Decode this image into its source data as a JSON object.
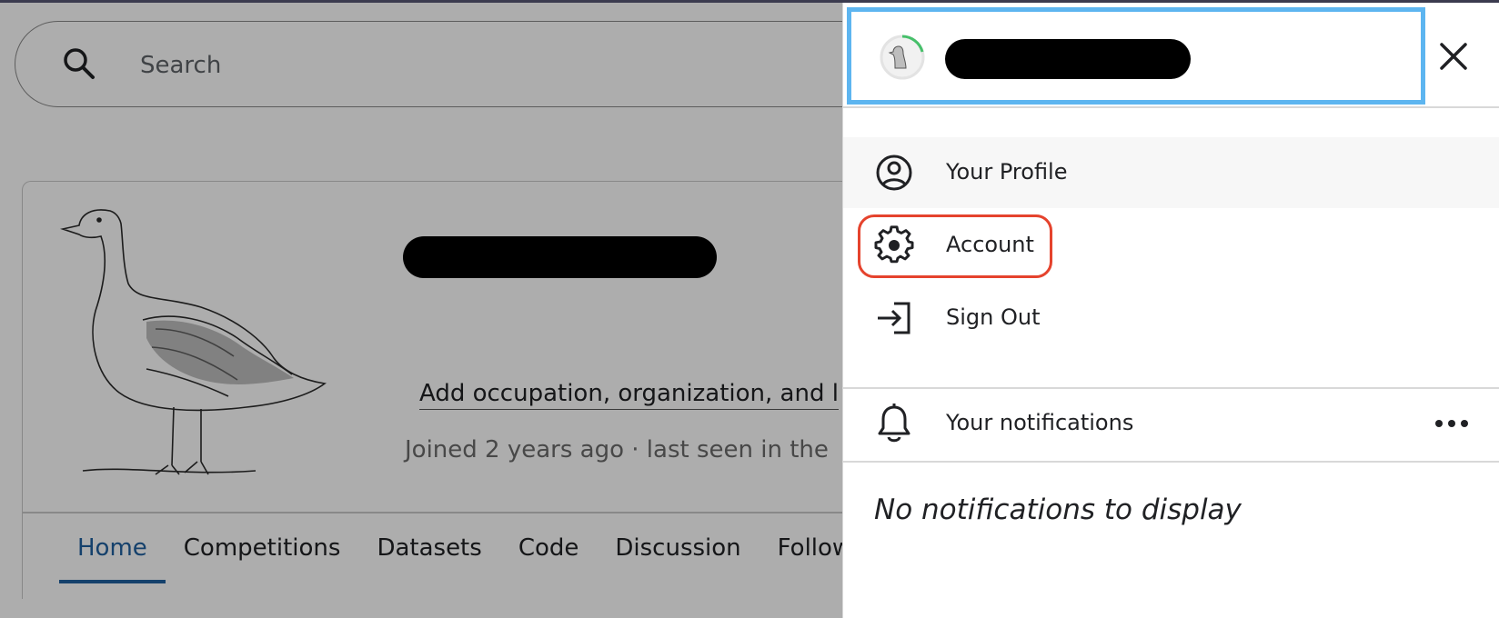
{
  "search": {
    "placeholder": "Search"
  },
  "profile": {
    "add_details_link": "Add occupation, organization, and l",
    "joined_text": "Joined 2 years ago · last seen in the",
    "tabs": [
      {
        "label": "Home",
        "active": true
      },
      {
        "label": "Competitions"
      },
      {
        "label": "Datasets"
      },
      {
        "label": "Code"
      },
      {
        "label": "Discussion"
      },
      {
        "label": "Follow"
      }
    ]
  },
  "drawer": {
    "menu": [
      {
        "label": "Your Profile",
        "icon": "user-circle-icon"
      },
      {
        "label": "Account",
        "icon": "gear-icon",
        "highlighted": true
      },
      {
        "label": "Sign Out",
        "icon": "sign-out-icon"
      }
    ],
    "notifications": {
      "title": "Your notifications",
      "empty_text": "No notifications to display"
    }
  },
  "colors": {
    "header_border": "#5db5f0",
    "highlight_border": "#e5432d",
    "active_tab": "#20609f",
    "progress_ring": "#46c06a"
  }
}
